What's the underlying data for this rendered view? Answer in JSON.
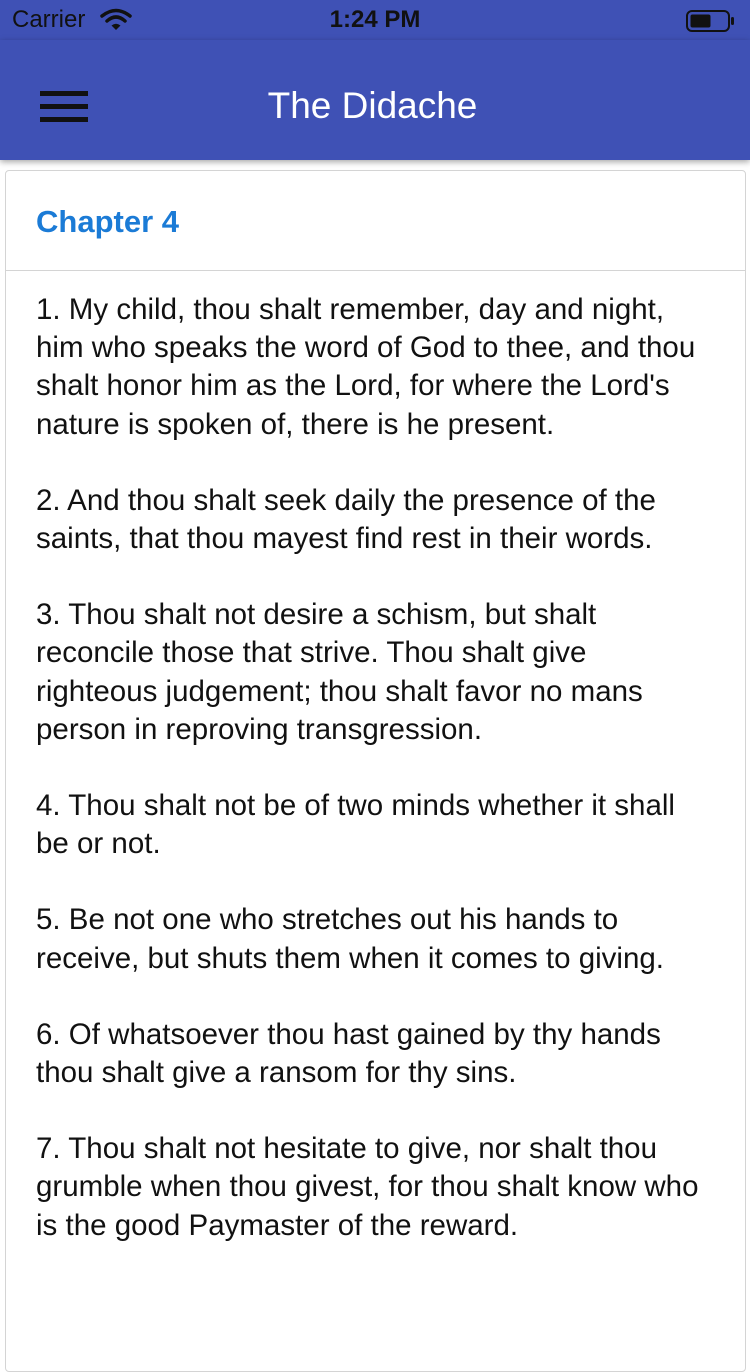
{
  "status_bar": {
    "carrier": "Carrier",
    "time": "1:24 PM",
    "wifi_icon": "wifi-icon",
    "battery_icon": "battery-icon"
  },
  "app_bar": {
    "title": "The Didache",
    "menu_icon": "hamburger-menu-icon",
    "color": "#3f51b5"
  },
  "chapter": {
    "title": "Chapter 4",
    "title_color": "#1b7bd6",
    "verses": [
      "1. My child, thou shalt remember, day and night, him who speaks the word of God to thee, and thou shalt honor him as the Lord, for where the Lord's nature is spoken of, there is he present.",
      "2. And thou shalt seek daily the presence of the saints, that thou mayest find rest in their words.",
      "3. Thou shalt not desire a schism, but shalt reconcile those that strive. Thou shalt give righteous judgement; thou shalt favor no mans person in reproving transgression.",
      "4. Thou shalt not be of two minds whether it shall be or not.",
      "5. Be not one who stretches out his hands to receive, but shuts them when it comes to giving.",
      "6. Of whatsoever thou hast gained by thy hands thou shalt give a ransom for thy sins.",
      "7. Thou shalt not hesitate to give, nor shalt thou grumble when thou givest, for thou shalt know who is the good Paymaster of the reward."
    ]
  }
}
